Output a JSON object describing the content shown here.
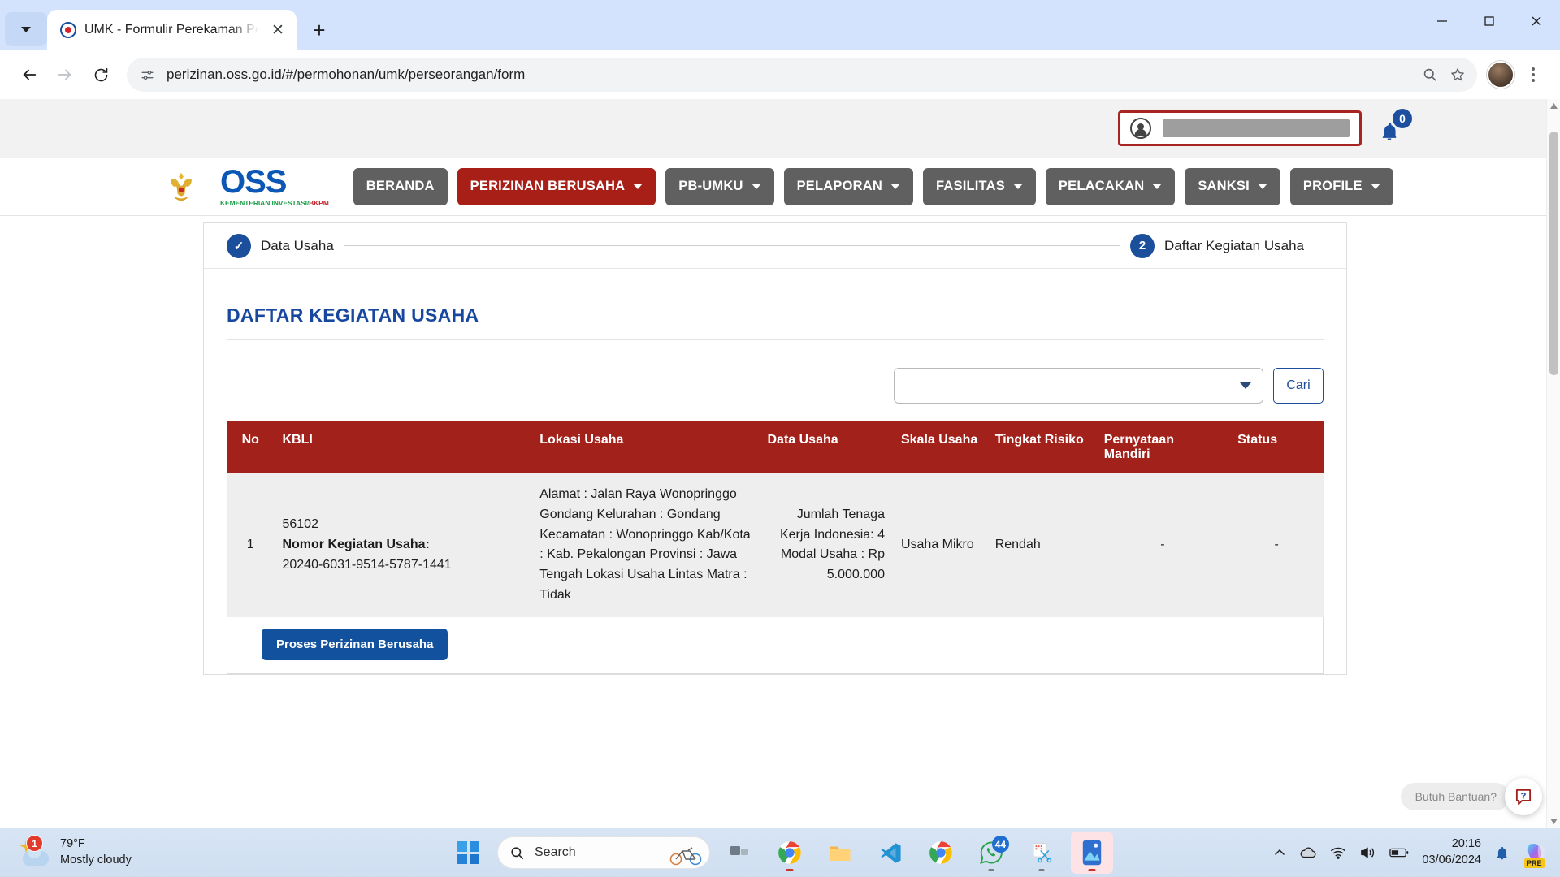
{
  "browser": {
    "tab": {
      "title": "UMK - Formulir Perekaman Pela",
      "close_label": "✕"
    },
    "new_tab_label": "+",
    "url": "perizinan.oss.go.id/#/permohonan/umk/perseorangan/form",
    "window_controls": {
      "minimize": "minimize-icon",
      "maximize": "maximize-icon",
      "close": "close-icon"
    },
    "icons": {
      "tab_list": "chevron-down-icon",
      "back": "back-arrow-icon",
      "forward": "forward-arrow-icon",
      "reload": "reload-icon",
      "site_info": "site-settings-icon",
      "zoom": "zoom-magnifier-icon",
      "bookmark": "star-icon",
      "profile": "profile-avatar-icon",
      "menu": "kebab-menu-icon"
    }
  },
  "site_header": {
    "user_account_value": "",
    "notification_count": "0",
    "brand": {
      "name": "OSS",
      "subtitle_1": "KEMENTERIAN INVESTASI/",
      "subtitle_2": "BKPM"
    },
    "nav": [
      {
        "label": "BERANDA",
        "has_caret": false,
        "active": false
      },
      {
        "label": "PERIZINAN BERUSAHA",
        "has_caret": true,
        "active": true
      },
      {
        "label": "PB-UMKU",
        "has_caret": true,
        "active": false
      },
      {
        "label": "PELAPORAN",
        "has_caret": true,
        "active": false
      },
      {
        "label": "FASILITAS",
        "has_caret": true,
        "active": false
      },
      {
        "label": "PELACAKAN",
        "has_caret": true,
        "active": false
      },
      {
        "label": "SANKSI",
        "has_caret": true,
        "active": false
      },
      {
        "label": "PROFILE",
        "has_caret": true,
        "active": false
      }
    ]
  },
  "stepper": {
    "steps": [
      {
        "marker": "✓",
        "label": "Data Usaha",
        "state": "completed"
      },
      {
        "marker": "2",
        "label": "Daftar Kegiatan Usaha",
        "state": "current"
      }
    ]
  },
  "main": {
    "page_title": "DAFTAR KEGIATAN USAHA",
    "filter": {
      "select_value": "",
      "select_placeholder": "",
      "search_button_label": "Cari"
    },
    "table": {
      "columns": [
        "No",
        "KBLI",
        "Lokasi Usaha",
        "Data Usaha",
        "Skala Usaha",
        "Tingkat Risiko",
        "Pernyataan Mandiri",
        "Status"
      ],
      "rows": [
        {
          "no": "1",
          "kbli_code": "56102",
          "kbli_label": "Nomor Kegiatan Usaha:",
          "kbli_number": "20240-6031-9514-5787-1441",
          "lokasi": "Alamat : Jalan Raya Wonopringgo Gondang Kelurahan : Gondang Kecamatan : Wonopringgo Kab/Kota : Kab. Pekalongan Provinsi : Jawa Tengah Lokasi Usaha Lintas Matra : Tidak",
          "data_usaha": "Jumlah Tenaga Kerja Indonesia: 4 Modal Usaha : Rp 5.000.000",
          "skala_usaha": "Usaha Mikro",
          "tingkat_risiko": "Rendah",
          "pernyataan_mandiri": "-",
          "status": "-"
        }
      ]
    },
    "process_button_label": "Proses Perizinan Berusaha"
  },
  "help_widget": {
    "bubble_text": "Butuh Bantuan?",
    "icon_label": "?"
  },
  "taskbar": {
    "weather": {
      "temperature": "79°F",
      "condition": "Mostly cloudy",
      "badge": "1"
    },
    "search_placeholder": "Search",
    "apps": [
      {
        "name": "task-view",
        "running": false
      },
      {
        "name": "chrome",
        "running": true
      },
      {
        "name": "file-explorer",
        "running": false
      },
      {
        "name": "vs-code",
        "running": false
      },
      {
        "name": "chrome-alt",
        "running": false
      },
      {
        "name": "whatsapp",
        "running": true,
        "badge": "44"
      },
      {
        "name": "snipping-tool",
        "running": true
      },
      {
        "name": "phone-link",
        "running": true
      }
    ],
    "clock": {
      "time": "20:16",
      "date": "03/06/2024"
    },
    "system_icons": [
      "show-hidden-icons",
      "onedrive-icon",
      "wifi-icon",
      "volume-icon",
      "battery-icon",
      "notification-bell-icon",
      "copilot-icon"
    ],
    "copilot_chip": "PRE"
  },
  "colors": {
    "brand_red": "#a3211b",
    "brand_blue": "#17479e",
    "nav_gray": "#606060",
    "accent_blue": "#11519e"
  }
}
